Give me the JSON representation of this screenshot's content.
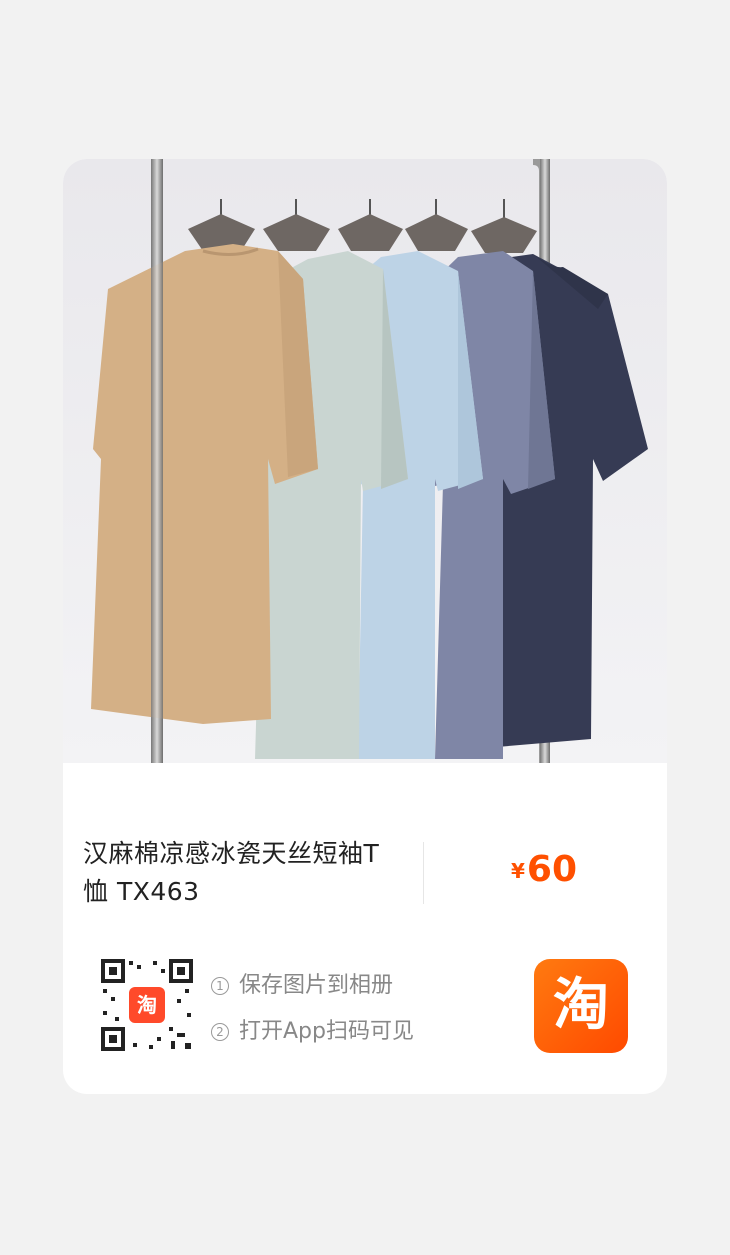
{
  "product": {
    "title": "汉麻棉凉感冰瓷天丝短袖T恤 TX463",
    "currency": "¥",
    "price": "60"
  },
  "share": {
    "steps": [
      {
        "num": "1",
        "text": "保存图片到相册"
      },
      {
        "num": "2",
        "text": "打开App扫码可见"
      }
    ],
    "taobao_logo_char": "淘",
    "qr_badge_text": "淘"
  },
  "photo": {
    "shirt_colors": [
      "#d4b086",
      "#c9d5d1",
      "#bdd3e6",
      "#7f86a6",
      "#363b54"
    ]
  },
  "colors": {
    "accent": "#ff5000"
  }
}
